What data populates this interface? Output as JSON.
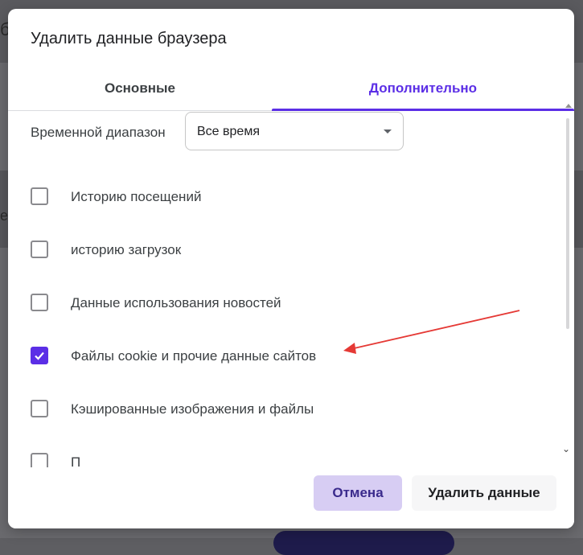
{
  "background": {
    "fragment_top": "б",
    "fragment_mid": "е"
  },
  "dialog": {
    "title": "Удалить данные браузера",
    "tabs": [
      {
        "label": "Основные",
        "active": false
      },
      {
        "label": "Дополнительно",
        "active": true
      }
    ],
    "time_range": {
      "label": "Временной диапазон",
      "selected": "Все время"
    },
    "options": [
      {
        "label": "Историю посещений",
        "checked": false
      },
      {
        "label": "историю загрузок",
        "checked": false
      },
      {
        "label": "Данные использования новостей",
        "checked": false
      },
      {
        "label": "Файлы cookie и прочие данные сайтов",
        "checked": true
      },
      {
        "label": "Кэшированные изображения и файлы",
        "checked": false
      },
      {
        "label": "П",
        "checked": false
      }
    ],
    "buttons": {
      "cancel": "Отмена",
      "delete": "Удалить данные"
    }
  },
  "colors": {
    "accent": "#5b2ee6",
    "annotation_arrow": "#e53935"
  },
  "icons": {
    "dropdown": "triangle-down",
    "checkmark": "check",
    "scroll_down": "chevron-down"
  }
}
